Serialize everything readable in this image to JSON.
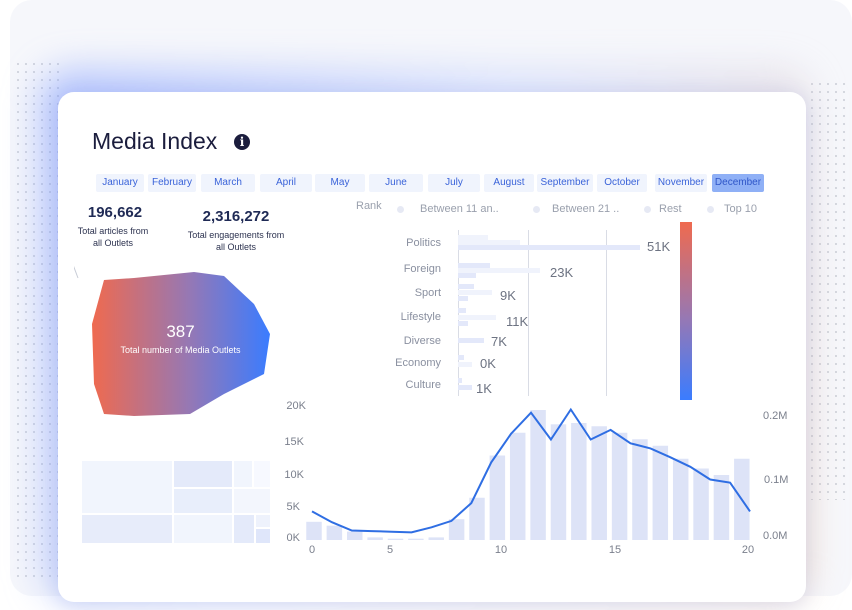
{
  "header": {
    "title": "Media Index",
    "info_icon": "info-icon"
  },
  "months": {
    "items": [
      "January",
      "February",
      "March",
      "April",
      "May",
      "June",
      "July",
      "August",
      "September",
      "October",
      "November",
      "December"
    ],
    "selected": "December"
  },
  "kpis": {
    "articles_value": "196,662",
    "articles_label_line1": "Total articles from",
    "articles_label_line2": "all Outlets",
    "engagements_value": "2,316,272",
    "engagements_label_line1": "Total engagements from",
    "engagements_label_line2": "all Outlets"
  },
  "outlets": {
    "value": "387",
    "label": "Total number of Media Outlets",
    "gradient_from": "#ef6a4f",
    "gradient_to": "#3a7cff"
  },
  "rank_legend": {
    "title": "Rank",
    "items": [
      "Between 11 an..",
      "Between 21 ..",
      "Rest",
      "Top 10"
    ]
  },
  "categories": {
    "items": [
      {
        "name": "Politics",
        "value_label": "51K",
        "value": 51
      },
      {
        "name": "Foreign",
        "value_label": "23K",
        "value": 23
      },
      {
        "name": "Sport",
        "value_label": "9K",
        "value": 9
      },
      {
        "name": "Lifestyle",
        "value_label": "11K",
        "value": 11
      },
      {
        "name": "Diverse",
        "value_label": "7K",
        "value": 7
      },
      {
        "name": "Economy",
        "value_label": "0K",
        "value": 0
      },
      {
        "name": "Culture",
        "value_label": "1K",
        "value": 1
      }
    ]
  },
  "chart_data": {
    "type": "bar",
    "x": [
      0,
      1,
      2,
      3,
      4,
      5,
      6,
      7,
      8,
      9,
      10,
      11,
      12,
      13,
      14,
      15,
      16,
      17,
      18,
      19,
      20
    ],
    "series": [
      {
        "type": "bar",
        "axis": "left",
        "values": [
          2800,
          2200,
          1300,
          400,
          200,
          200,
          400,
          3200,
          6500,
          13000,
          16500,
          20000,
          17800,
          18000,
          17500,
          16500,
          15500,
          14500,
          12500,
          11000,
          10000,
          12500
        ]
      },
      {
        "type": "line",
        "axis": "right",
        "values": [
          0.045,
          0.028,
          0.015,
          0.014,
          0.013,
          0.012,
          0.02,
          0.03,
          0.058,
          0.122,
          0.167,
          0.2,
          0.158,
          0.205,
          0.158,
          0.173,
          0.152,
          0.144,
          0.13,
          0.115,
          0.095,
          0.09,
          0.045
        ]
      }
    ],
    "left_ticks": [
      "0K",
      "5K",
      "10K",
      "15K",
      "20K"
    ],
    "right_ticks": [
      "0.0M",
      "0.1M",
      "0.2M"
    ],
    "x_ticks": [
      "0",
      "5",
      "10",
      "15",
      "20"
    ],
    "ylim_left": [
      0,
      20000
    ],
    "ylim_right": [
      0,
      0.22
    ],
    "bar_color": "#dde3f7",
    "line_color": "#2f6ee3"
  }
}
